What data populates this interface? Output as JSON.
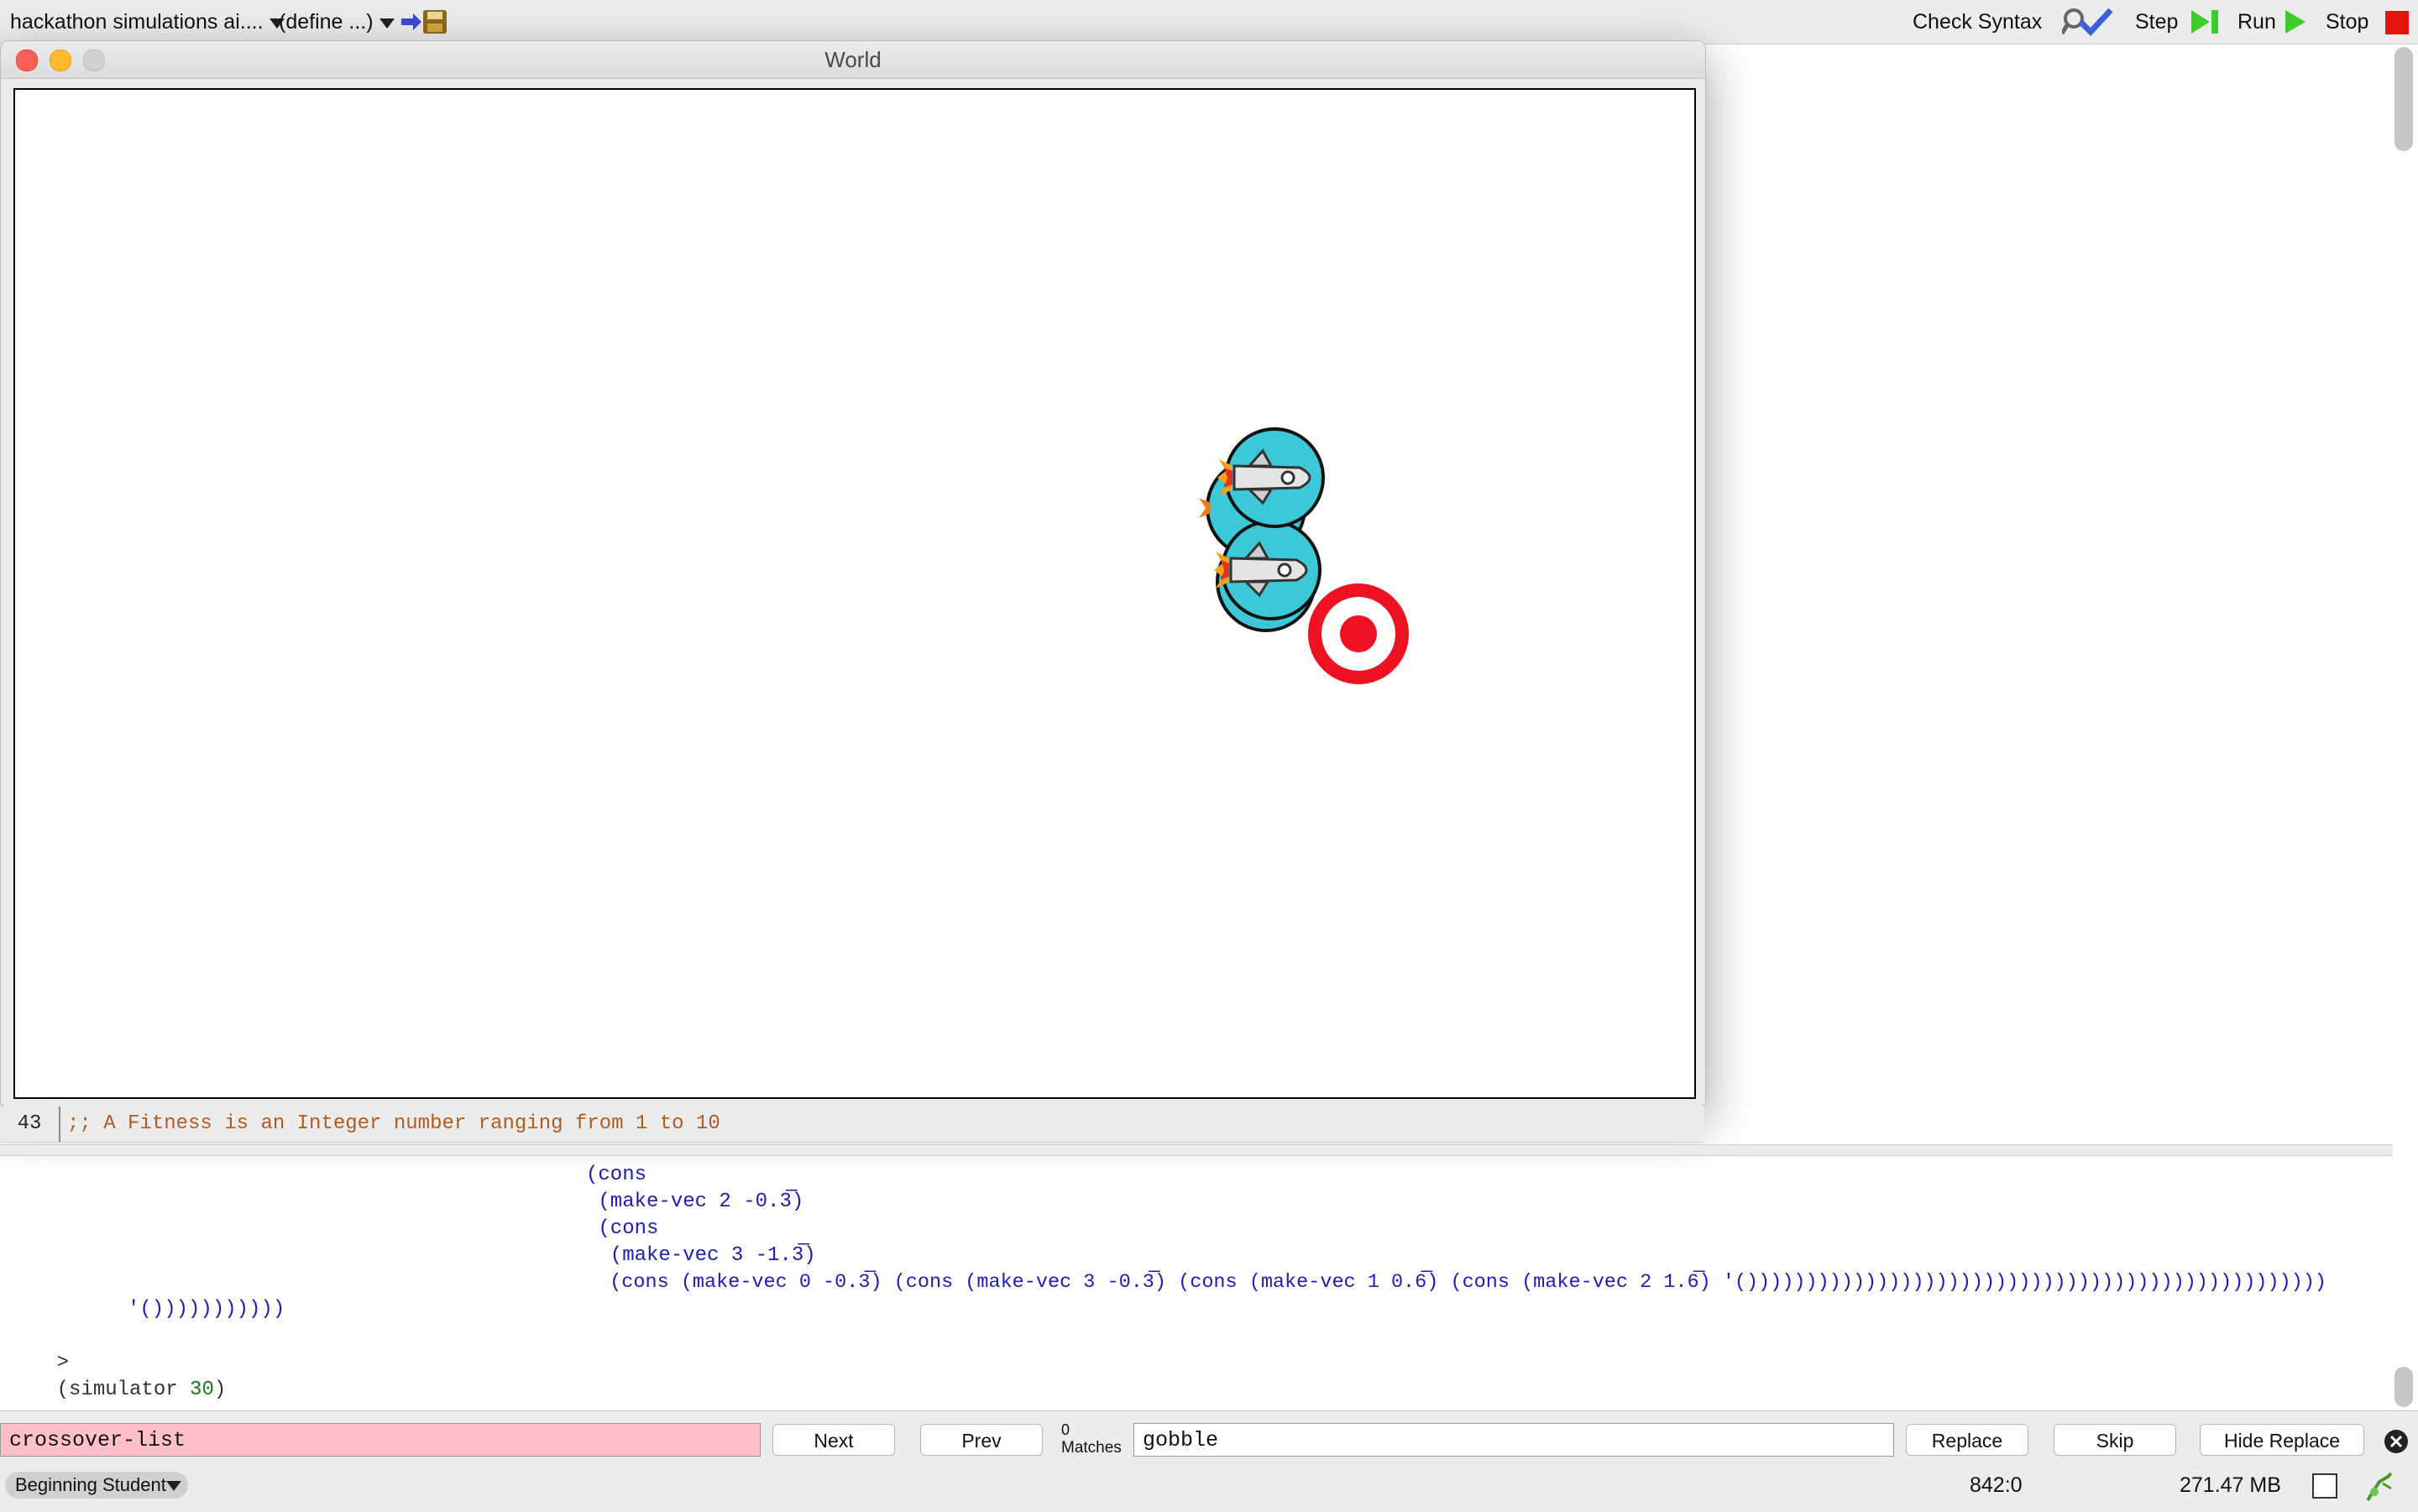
{
  "toolbar": {
    "file_name": "hackathon simulations ai....",
    "define_menu": "(define ...)",
    "check_syntax": "Check Syntax",
    "step": "Step",
    "run": "Run",
    "stop": "Stop"
  },
  "world_window": {
    "title": "World"
  },
  "definitions": {
    "line_number": "43",
    "line_text": ";; A Fitness is an Integer number ranging from 1 to 10"
  },
  "interactions": {
    "lines": [
      "(cons",
      " (make-vec 2 -0.3̅)",
      " (cons",
      "  (make-vec 3 -1.3̅)",
      "  (cons (make-vec 0 -0.3̅) (cons (make-vec 3 -0.3̅) (cons (make-vec 1 0.6̅) (cons (make-vec 2 1.6̅) '()))))))))))))))))))))))))))))))))))))))))))))))))",
      "'()))))))))))"
    ],
    "prompt": ">",
    "command_open": "(simulator ",
    "command_arg": "30",
    "command_close": ")"
  },
  "search": {
    "find_value": "crossover-list",
    "next_label": "Next",
    "prev_label": "Prev",
    "matches_count": "0",
    "matches_label": "Matches",
    "replace_value": "gobble",
    "replace_label": "Replace",
    "skip_label": "Skip",
    "hide_replace_label": "Hide Replace"
  },
  "status_bar": {
    "language": "Beginning Student",
    "position": "842:0",
    "memory": "271.47 MB"
  },
  "colors": {
    "find_field_bg": "#ffc0cb",
    "ship_body": "#3cc8d6",
    "target_red": "#ee1122",
    "code_blue": "#1d1db5",
    "comment_brown": "#b35a1f"
  },
  "icons": [
    "save-icon",
    "magnifier-check-icon",
    "step-icon",
    "run-icon",
    "stop-icon",
    "close-search-icon",
    "gc-icon"
  ]
}
